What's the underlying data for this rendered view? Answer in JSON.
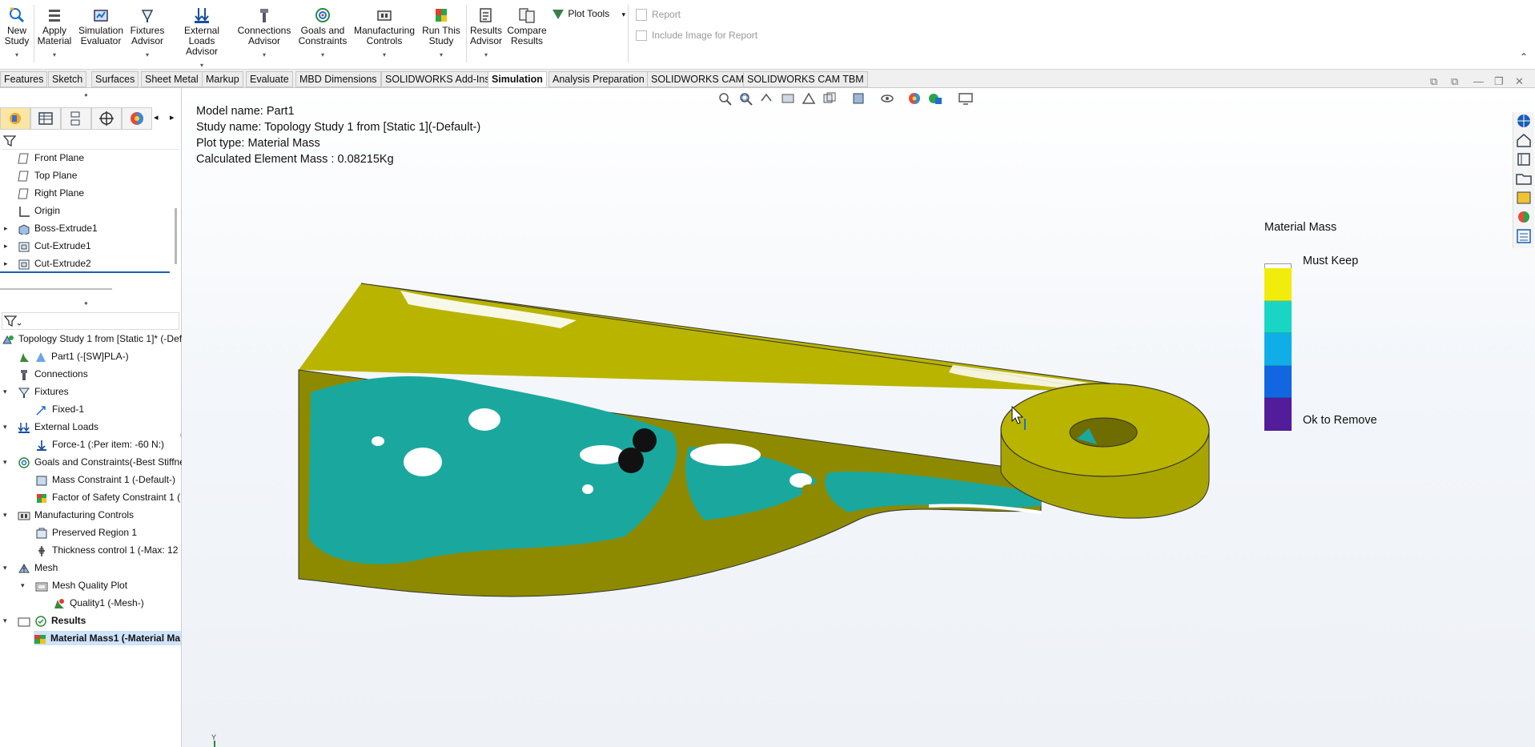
{
  "ribbon": {
    "buttons": [
      {
        "line1": "New",
        "line2": "Study"
      },
      {
        "line1": "Apply",
        "line2": "Material"
      },
      {
        "line1": "Simulation",
        "line2": "Evaluator"
      },
      {
        "line1": "Fixtures",
        "line2": "Advisor"
      },
      {
        "line1": "External Loads",
        "line2": "Advisor"
      },
      {
        "line1": "Connections",
        "line2": "Advisor"
      },
      {
        "line1": "Goals and",
        "line2": "Constraints"
      },
      {
        "line1": "Manufacturing",
        "line2": "Controls"
      },
      {
        "line1": "Run This",
        "line2": "Study"
      },
      {
        "line1": "Results",
        "line2": "Advisor"
      },
      {
        "line1": "Compare",
        "line2": "Results"
      }
    ],
    "plot_tools": "Plot Tools",
    "report": "Report",
    "include_image": "Include Image for Report"
  },
  "tabs": [
    "Features",
    "Sketch",
    "Surfaces",
    "Sheet Metal",
    "Markup",
    "Evaluate",
    "MBD Dimensions",
    "SOLIDWORKS Add-Ins",
    "Simulation",
    "Analysis Preparation",
    "SOLIDWORKS CAM",
    "SOLIDWORKS CAM TBM"
  ],
  "active_tab": "Simulation",
  "feature_tree": [
    "Front Plane",
    "Top Plane",
    "Right Plane",
    "Origin",
    "Boss-Extrude1",
    "Cut-Extrude1",
    "Cut-Extrude2"
  ],
  "study_tree": [
    "Topology Study 1 from [Static 1]* (-Def",
    "Part1 (-[SW]PLA-)",
    "Connections",
    "Fixtures",
    "Fixed-1",
    "External Loads",
    "Force-1 (:Per item: -60 N:)",
    "Goals and Constraints(-Best Stiffne",
    "Mass Constraint 1 (-Default-)",
    "Factor of Safety Constraint 1 (",
    "Manufacturing Controls",
    "Preserved Region 1",
    "Thickness control 1 (-Max: 12",
    "Mesh",
    "Mesh Quality Plot",
    "Quality1 (-Mesh-)",
    "Results",
    "Material Mass1 (-Material Ma"
  ],
  "info": {
    "model_name": "Model name: Part1",
    "study_name": "Study name: Topology Study 1 from [Static 1](-Default-)",
    "plot_type": "Plot type: Material Mass",
    "mass": "Calculated Element Mass :  0.08215Kg"
  },
  "legend": {
    "title": "Material Mass",
    "top_label": "Must Keep",
    "bottom_label": "Ok to Remove",
    "colors": [
      "#f2ec0c",
      "#19d6c4",
      "#10aee6",
      "#1266e0",
      "#531c9a"
    ]
  },
  "triad_label": "Y",
  "colors": {
    "model_yellow": "#b8b400",
    "model_cyan": "#1aa89e",
    "accent": "#0a5fb4"
  }
}
